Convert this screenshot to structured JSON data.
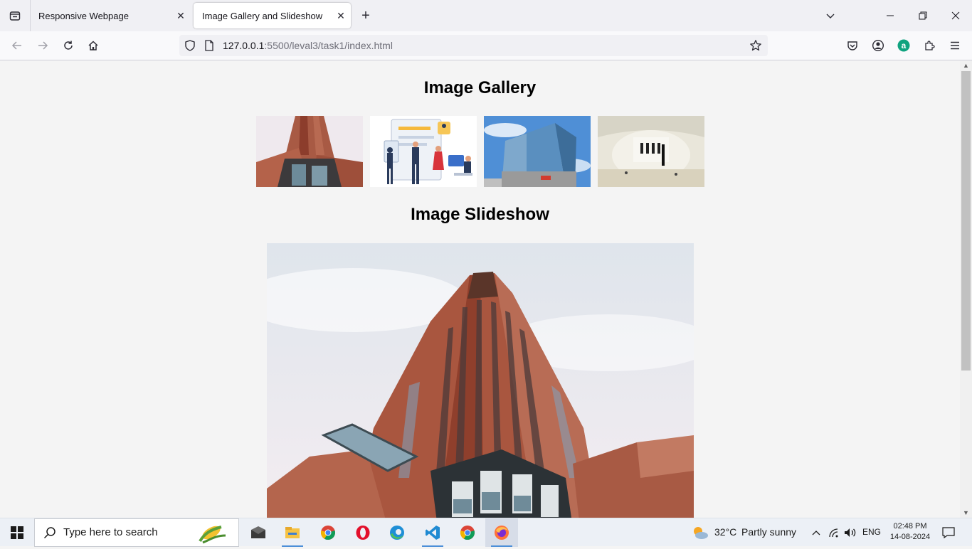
{
  "browser": {
    "tabs": [
      {
        "title": "Responsive Webpage",
        "active": false
      },
      {
        "title": "Image Gallery and Slideshow",
        "active": true
      }
    ],
    "url_host": "127.0.0.1",
    "url_rest": ":5500/leval3/task1/index.html",
    "icons": [
      "tab-list-icon",
      "close-icon",
      "new-tab-icon",
      "chevron-down-icon",
      "minimize-icon",
      "restore-icon",
      "window-close-icon",
      "back-icon",
      "forward-icon",
      "reload-icon",
      "home-icon",
      "shield-icon",
      "page-icon",
      "star-icon",
      "pocket-icon",
      "account-icon",
      "extension-a-icon",
      "extensions-icon",
      "menu-icon"
    ]
  },
  "page": {
    "gallery_title": "Image Gallery",
    "slideshow_title": "Image Slideshow",
    "thumbnails": [
      {
        "alt": "brick skyscraper"
      },
      {
        "alt": "office team illustration"
      },
      {
        "alt": "glass office building"
      },
      {
        "alt": "museum great court"
      }
    ]
  },
  "taskbar": {
    "search_placeholder": "Type here to search",
    "weather_temp": "32°C",
    "weather_desc": "Partly sunny",
    "language": "ENG",
    "time": "02:48 PM",
    "date": "14-08-2024"
  },
  "colors": {
    "page_background": "#f4f4f4",
    "active_tab": "#ffffff",
    "tabstrip": "#f0f0f4",
    "taskbar": "#ecf0f6"
  }
}
